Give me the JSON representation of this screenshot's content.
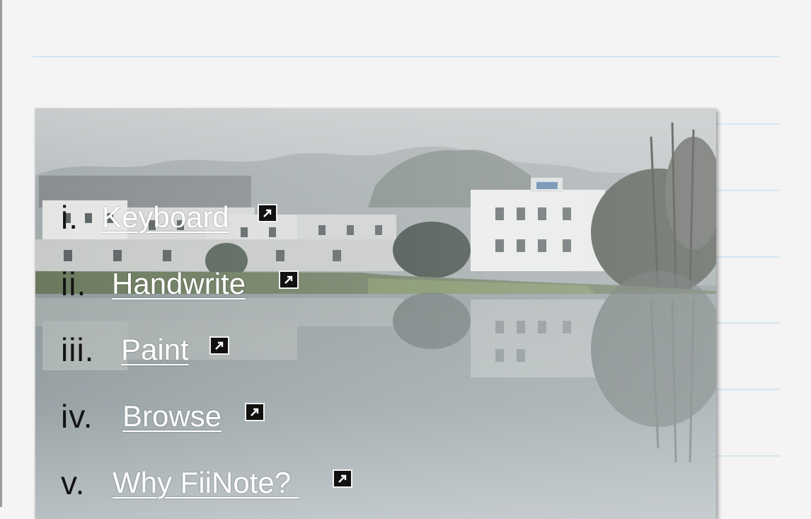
{
  "menu": {
    "items": [
      {
        "numeral": "i.",
        "label": "Keyboard",
        "icon": "external-link-icon"
      },
      {
        "numeral": "ii.",
        "label": "Handwrite",
        "icon": "external-link-icon"
      },
      {
        "numeral": "iii.",
        "label": "Paint",
        "icon": "external-link-icon"
      },
      {
        "numeral": "iv.",
        "label": "Browse",
        "icon": "external-link-icon"
      },
      {
        "numeral": "v.",
        "label": "Why FiiNote? ",
        "icon": "external-link-icon"
      }
    ]
  },
  "colors": {
    "background": "#f4f4f4",
    "rule_line": "#d3e7f1",
    "link_text": "#ffffff",
    "numeral_text": "#141414"
  }
}
